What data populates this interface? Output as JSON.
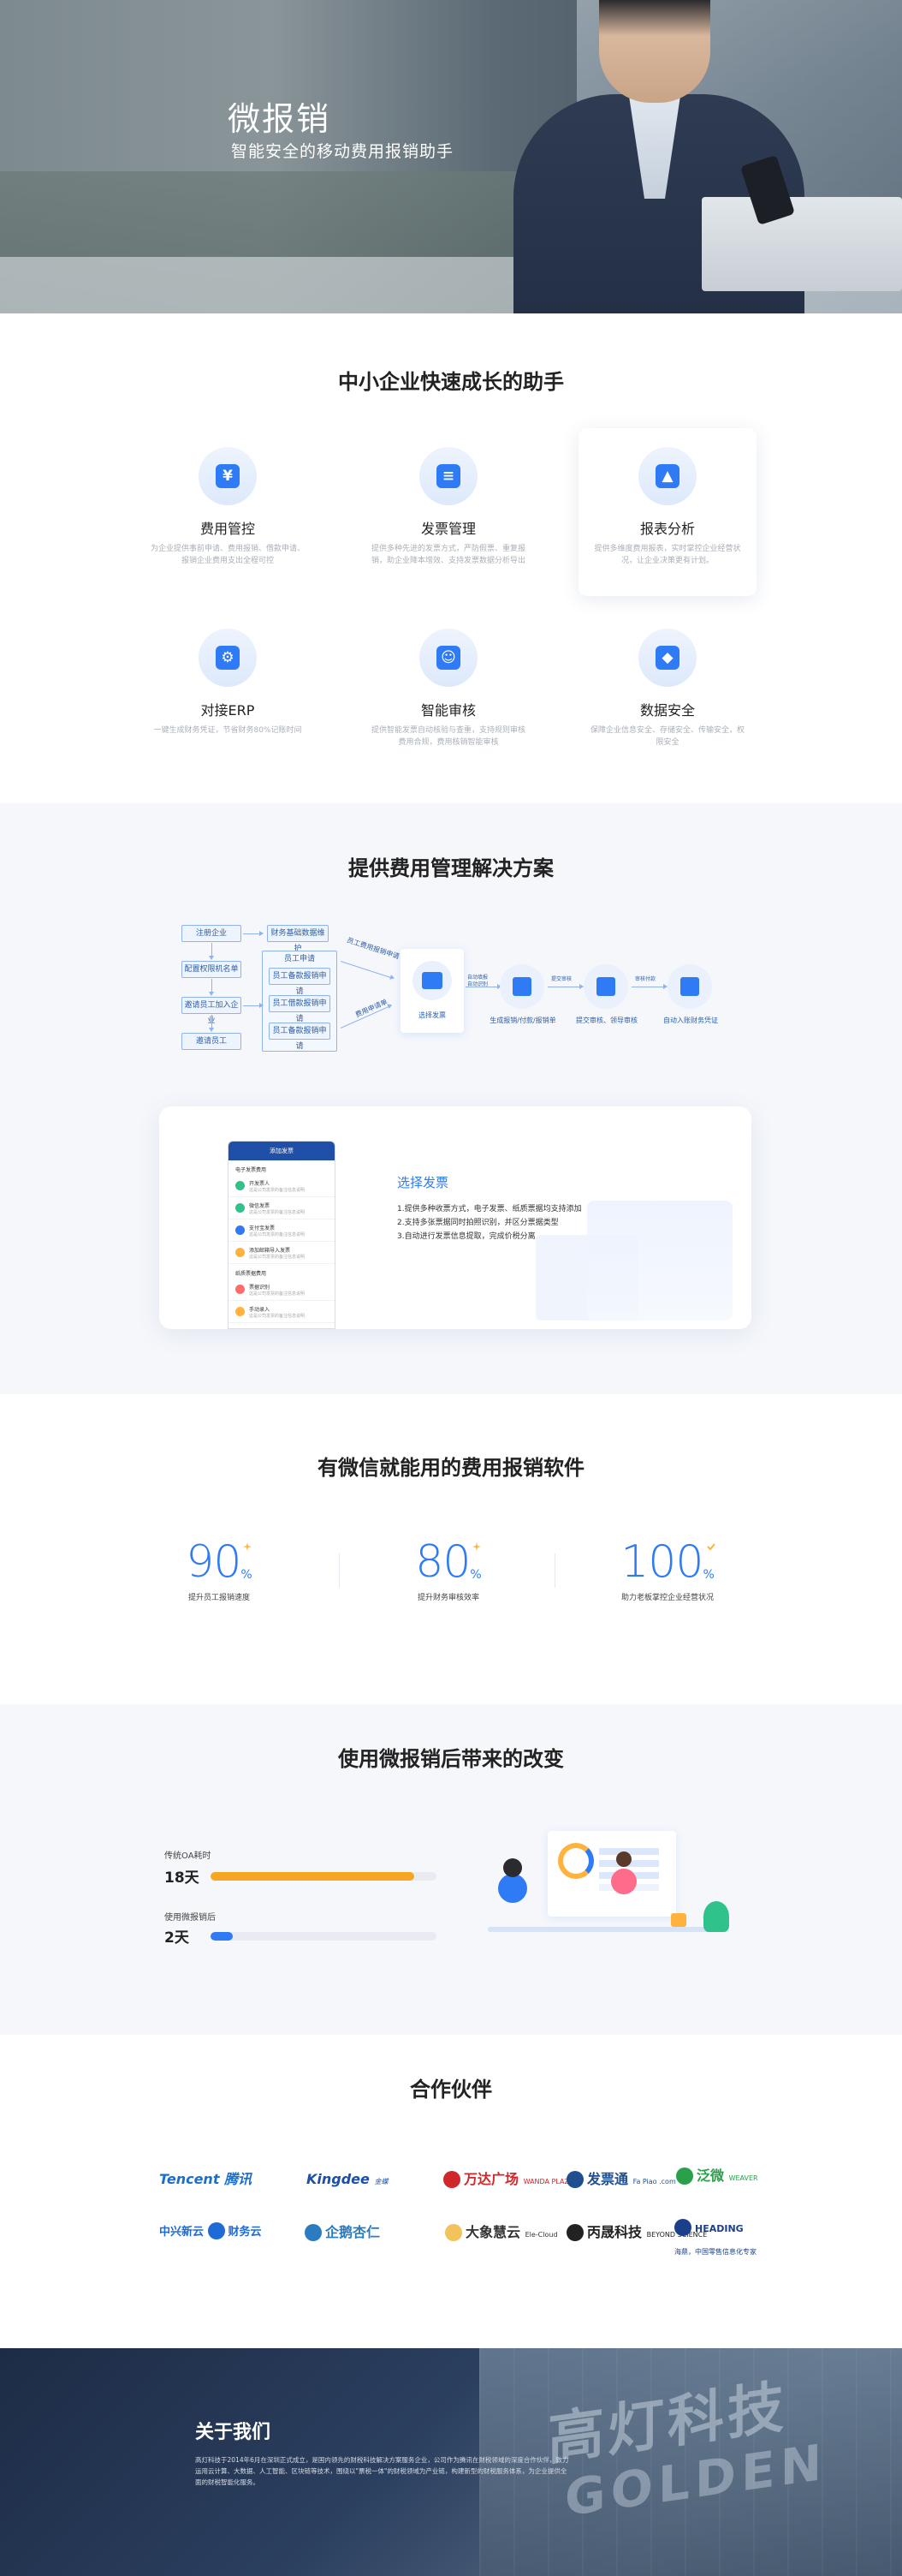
{
  "hero": {
    "title": "微报销",
    "subtitle": "智能安全的移动费用报销助手"
  },
  "features": {
    "title": "中小企业快速成长的助手",
    "items": [
      {
        "title": "费用管控",
        "desc": "为企业提供事前申请、费用报销、借款申请、报销企业费用支出全程可控",
        "icon": "yen-icon",
        "glyph": "¥"
      },
      {
        "title": "发票管理",
        "desc": "提供多种先进的发票方式，严防假票、重复报销，助企业降本增效、支持发票数据分析导出",
        "icon": "invoice-icon",
        "glyph": "≡"
      },
      {
        "title": "报表分析",
        "desc": "提供多维度费用报表，实时掌控企业经营状况，让企业决策更有计划。",
        "icon": "chart-icon",
        "glyph": "▲"
      },
      {
        "title": "对接ERP",
        "desc": "一键生成财务凭证，节省财务80%记账时间",
        "icon": "gear-icon",
        "glyph": "⚙"
      },
      {
        "title": "智能审核",
        "desc": "提供智能发票自动核验与查重，支持规则审核费用合规，费用核销智能审核",
        "icon": "user-icon",
        "glyph": "☺"
      },
      {
        "title": "数据安全",
        "desc": "保障企业信息安全、存储安全、传输安全，权限安全",
        "icon": "shield-icon",
        "glyph": "◆"
      }
    ]
  },
  "solution": {
    "title": "提供费用管理解决方案",
    "left_boxes": [
      "注册企业",
      "配置权限机名单",
      "邀请员工加入企业",
      "邀请员工"
    ],
    "mid_boxes": [
      "财务基础数据维护"
    ],
    "group_label": "员工申请",
    "group_items": [
      "员工备款报销申请",
      "员工借款报销申请",
      "员工备款报销申请"
    ],
    "arrow_labels": [
      "员工费用报销申请",
      "费用申请单"
    ],
    "card_caption": "选择发票",
    "steps": [
      {
        "caption": "生成报销/付款/报销单"
      },
      {
        "caption": "提交审核、领导审核"
      },
      {
        "caption": "自动入账财务凭证"
      }
    ],
    "step_labels": [
      "自动填报\n自动识别",
      "提交审核",
      "审核付款"
    ],
    "demo": {
      "phone_title": "添加发票",
      "phone_subtitle": "电子发票费用",
      "rows": [
        {
          "t": "开发票人",
          "s": "这是公司发票的备注信息说明",
          "color": "#2fc28b"
        },
        {
          "t": "微信发票",
          "s": "这是公司发票的备注信息说明",
          "color": "#2fc28b"
        },
        {
          "t": "支付宝发票",
          "s": "这是公司发票的备注信息说明",
          "color": "#2f7af5"
        },
        {
          "t": "添加邮箱导入发票",
          "s": "这是公司发票的备注信息说明",
          "color": "#ffb23e"
        }
      ],
      "group2": "纸质票据费用",
      "rows2": [
        {
          "t": "票据识别",
          "s": "这是公司发票的备注信息说明",
          "color": "#ff6b6b"
        },
        {
          "t": "手动录入",
          "s": "这是公司发票的备注信息说明",
          "color": "#ffb23e"
        }
      ],
      "title": "选择发票",
      "lines": [
        "1.提供多种收票方式，电子发票、纸质票据均支持添加",
        "2.支持多张票据同时拍照识别，并区分票据类型",
        "3.自动进行发票信息提取，完成价税分离"
      ]
    }
  },
  "stats": {
    "title": "有微信就能用的费用报销软件",
    "items": [
      {
        "num": "90",
        "pct": "%",
        "cap": "提升员工报销速度",
        "spark": "#ffb23e"
      },
      {
        "num": "80",
        "pct": "%",
        "cap": "提升财务审核效率",
        "spark": "#ffb23e"
      },
      {
        "num": "100",
        "pct": "%",
        "cap": "助力老板掌控企业经营状况",
        "spark": "#ffb23e"
      }
    ]
  },
  "changes": {
    "title": "使用微报销后带来的改变",
    "bars": [
      {
        "label": "传统OA耗时",
        "value": "18天",
        "fraction": 0.9,
        "color": "#f5a623"
      },
      {
        "label": "使用微报销后",
        "value": "2天",
        "fraction": 0.1,
        "color": "#2f7af5"
      }
    ]
  },
  "partners": {
    "title": "合作伙伴",
    "logos": [
      {
        "name": "Tencent",
        "sub": "腾讯",
        "color": "#1b6fcb"
      },
      {
        "name": "Kingdee",
        "sub": "金蝶",
        "color": "#1b4fa8"
      },
      {
        "name": "万达广场",
        "sub": "WANDA PLAZA",
        "color": "#d0272a"
      },
      {
        "name": "发票通",
        "sub": "Fa Piao .com",
        "color": "#1f4f8f"
      },
      {
        "name": "泛微",
        "sub": "WEAVER",
        "color": "#2aa04a"
      },
      {
        "name": "中兴新云",
        "sub": "财务云",
        "color": "#1e6ad6"
      },
      {
        "name": "企鹅杏仁",
        "sub": "",
        "color": "#2b7bc0"
      },
      {
        "name": "大象慧云",
        "sub": "Ele-Cloud",
        "color": "#333333"
      },
      {
        "name": "丙晟科技",
        "sub": "BEYOND SCIENCE",
        "color": "#222222"
      },
      {
        "name": "HEADING",
        "sub": "海鼎，中国零售信息化专家",
        "color": "#1b3f8a"
      }
    ]
  },
  "about": {
    "title": "关于我们",
    "text": "高灯科技于2014年6月在深圳正式成立，是国内领先的财税科技解决方案服务企业，公司作为腾讯在财税领域的深度合作伙伴，致力运用云计算、大数据、人工智能、区块链等技术，围绕以\"票税一体\"的财税领域为产业链，构建新型的财税服务体系，为企业提供全面的财税智能化服务。",
    "sign_line1": "高灯科技",
    "sign_line2": "GOLDEN"
  }
}
